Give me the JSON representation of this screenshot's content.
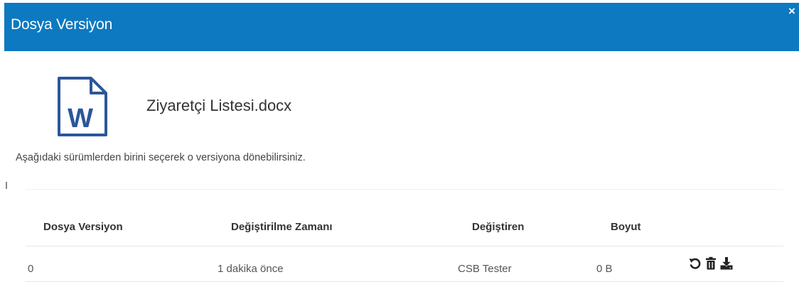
{
  "dialog": {
    "title": "Dosya Versiyon",
    "close_label": "×"
  },
  "file": {
    "icon": "word-document-icon",
    "icon_letter": "W",
    "name": "Ziyaretçi Listesi.docx"
  },
  "description": "Aşağıdaki sürümlerden birini seçerek o versiyona dönebilirsiniz.",
  "table": {
    "columns": [
      "Dosya Versiyon",
      "Değiştirilme Zamanı",
      "Değiştiren",
      "Boyut"
    ],
    "rows": [
      {
        "version": "0",
        "modified": "1 dakika önce",
        "modified_by": "CSB Tester",
        "size": "0 B",
        "actions": [
          "revert-icon",
          "trash-icon",
          "download-icon"
        ]
      }
    ]
  },
  "colors": {
    "header_bg": "#0d79c0",
    "word_blue": "#2b579a"
  }
}
